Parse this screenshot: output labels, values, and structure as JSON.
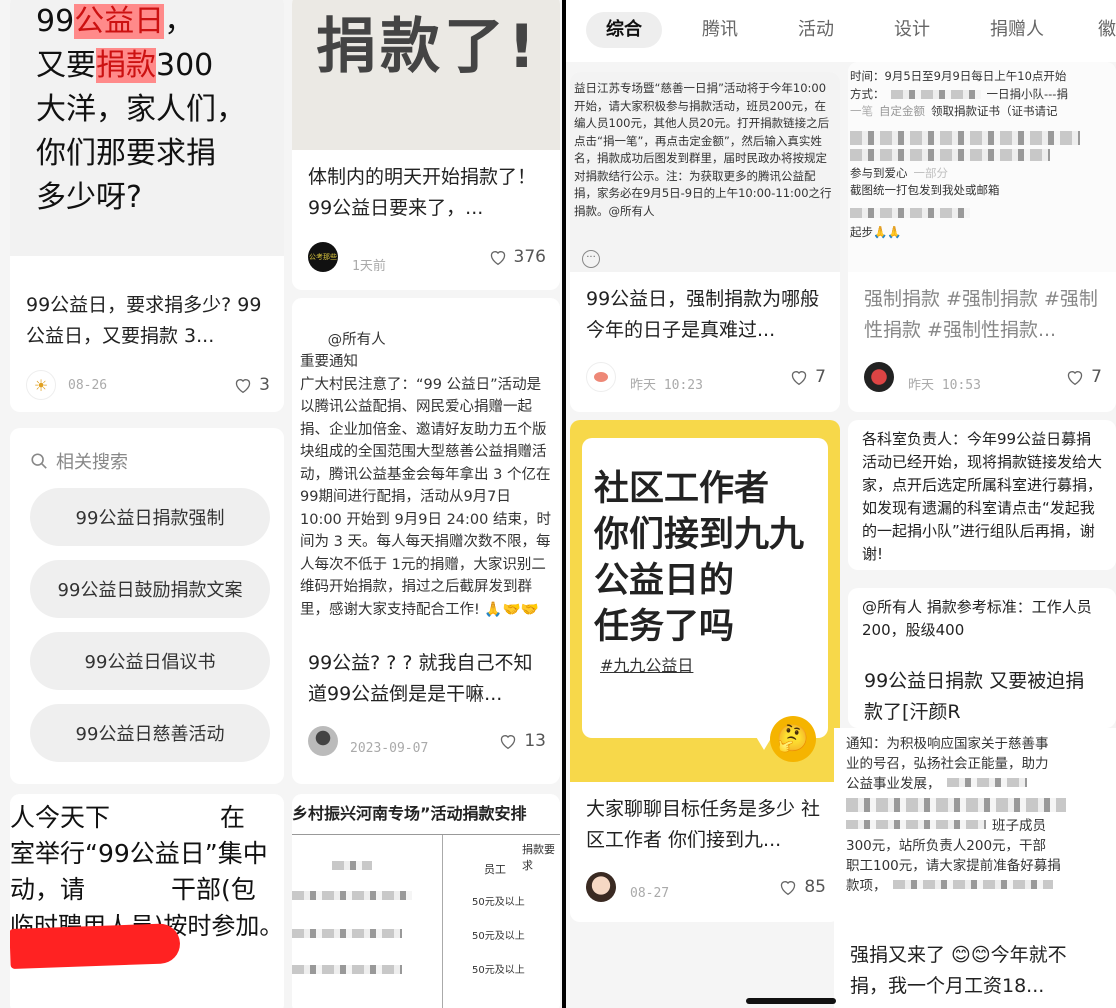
{
  "left": {
    "c1": {
      "img_lines": [
        "99公益日，",
        "又要捐款300",
        "大洋，家人们，",
        "你们那要求捐",
        "多少呀?"
      ],
      "img_hl": [
        "公益日",
        "捐款"
      ],
      "title": "99公益日，要求捐多少? 99公益日，又要捐款 3...",
      "date": "08-26",
      "likes": "3"
    },
    "c2": {
      "img_text": "捐款了!",
      "title": "体制内的明天开始捐款了！ 99公益日要来了，...",
      "avatar_text": "公考那些",
      "date": "1天前",
      "likes": "376"
    },
    "c3": {
      "img_text": "@所有人\n重要通知\n广大村民注意了：“99 公益日”活动是以腾讯公益配捐、网民爱心捐赠一起捐、企业加倍金、邀请好友助力五个版块组成的全国范围大型慈善公益捐赠活动，腾讯公益基金会每年拿出 3 个亿在 99期间进行配捐，活动从9月7日10:00 开始到 9月9日 24:00 结束，时间为 3 天。每人每天捐赠次数不限，每人每次不低于 1元的捐赠，大家识别二维码开始捐款，捐过之后截屏发到群里，感谢大家支持配合工作! 🙏🤝🤝",
      "title": "99公益? ? ? 就我自己不知道99公益倒是是干嘛...",
      "date": "2023-09-07",
      "likes": "13"
    },
    "related": {
      "header": "相关搜索",
      "items": [
        "99公益日捐款强制",
        "99公益日鼓励捐款文案",
        "99公益日倡议书",
        "99公益日慈善活动"
      ]
    },
    "c5": {
      "lines": [
        "人今天下",
        "在",
        "室举行“99公益日”集中",
        "动，请",
        "干部(包",
        "临时聘用人员)按时参加。"
      ]
    },
    "c6": {
      "heading": "乡村振兴河南专场”活动捐款安排",
      "table_header": "捐款要求",
      "col": "员工",
      "rows": [
        "50元及以上",
        "50元及以上",
        "50元及以上"
      ]
    }
  },
  "right": {
    "tabs": [
      "综合",
      "腾讯",
      "活动",
      "设计",
      "捐赠人",
      "徽"
    ],
    "c1": {
      "img_text": "益日江苏专场暨“慈善一日捐”活动将于今年10:00开始，请大家积极参与捐款活动，班员200元，在编人员100元，其他人员20元。打开捐款链接之后点击“捐一笔”，再点击定金额”，然后输入真实姓名，捐款成功后图发到群里，届时民政办将按规定对捐款结行公示。注：为获取更多的腾讯公益配捐，家务必在9月5日-9日的上午10:00-11:00之行捐款。@所有人",
      "title": "99公益日，强制捐款为哪般 今年的日子是真难过...",
      "date": "昨天 10:23",
      "likes": "7"
    },
    "c2": {
      "img_lines": [
        "时间：9月5日至9月9日每日上午10点开始",
        "方式：",
        "一日捐小队---捐",
        "一笔",
        "自定金额",
        "领取捐款证书（证书请记",
        "参与到爱心",
        "一部分",
        "截图统一打包发到我处或邮箱",
        "起步🙏🙏"
      ],
      "title": "强制捐款 #强制捐款 #强制性捐款 #强制性捐款...",
      "date": "昨天 10:53",
      "likes": "7"
    },
    "c3": {
      "img_lines": [
        "社区工作者",
        "你们接到九九",
        "公益日的",
        "任务了吗"
      ],
      "tag": "#九九公益日",
      "title": "大家聊聊目标任务是多少 社区工作者 你们接到九...",
      "date": "08-27",
      "likes": "85"
    },
    "c4": {
      "text": "各科室负责人：今年99公益日募捐活动已经开始，现将捐款链接发给大家，点开后选定所属科室进行募捐，如发现有遗漏的科室请点击“发起我的一起捐小队”进行组队后再捐，谢谢!"
    },
    "c5": {
      "img_text": "@所有人 捐款参考标准：工作人员200，股级400",
      "title": "99公益日捐款 又要被迫捐款了[汗颜R"
    },
    "c6": {
      "lines": [
        "通知：为积极响应国家关于慈善事",
        "业的号召，弘扬社会正能量，助力",
        "公益事业发展，",
        "班子成员",
        "300元，站所负责人200元，干部",
        "职工100元，请大家提前准备好募捐",
        "款项，"
      ],
      "title": "强捐又来了 😊😊今年就不捐，我一个月工资18..."
    }
  },
  "colors": {
    "accent_red": "#ff2442",
    "yellow": "#f5d63a",
    "chip_bg": "#efefef"
  }
}
